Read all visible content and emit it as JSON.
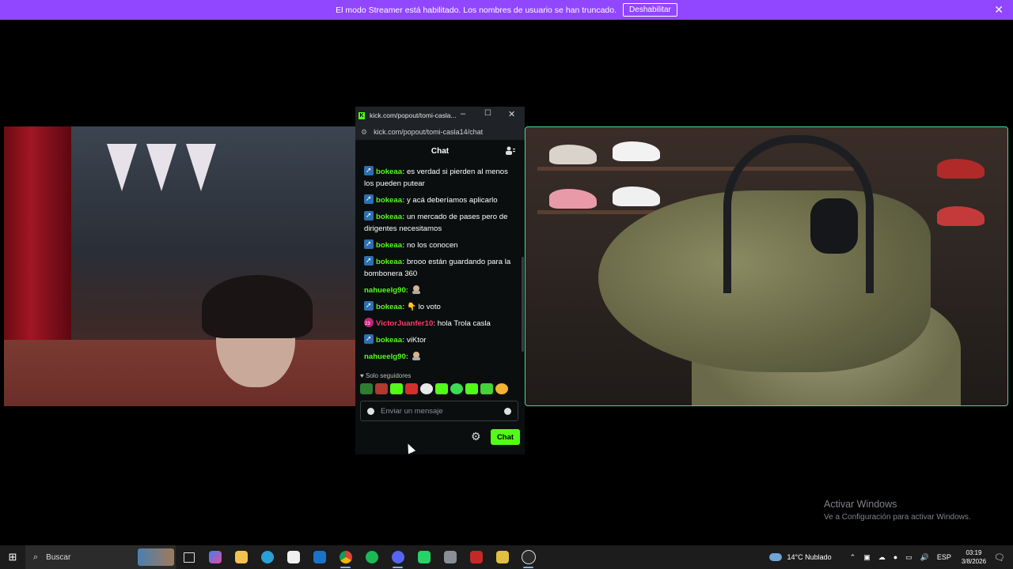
{
  "banner": {
    "text": "El modo Streamer está habilitado. Los nombres de usuario se han truncado.",
    "button": "Deshabilitar",
    "close": "✕"
  },
  "popup": {
    "window_title": "kick.com/popout/tomi-casla...",
    "url": "kick.com/popout/tomi-casla14/chat",
    "chat_title": "Chat",
    "messages": [
      {
        "user": "bokeaa",
        "text": "es verdad si pierden al menos los pueden putear"
      },
      {
        "user": "bokeaa",
        "text": "y acá deberíamos aplicarlo"
      },
      {
        "user": "bokeaa",
        "text": "un mercado de pases pero de dirigentes necesitamos"
      },
      {
        "user": "bokeaa",
        "text": "no los conocen"
      },
      {
        "user": "bokeaa",
        "text": "brooo están guardando para la bombonera 360"
      },
      {
        "user": "nahueelg90",
        "text": ""
      },
      {
        "user": "bokeaa",
        "text": "lo voto"
      },
      {
        "user": "VictorJuanfer10",
        "text": "hola Trola casla"
      },
      {
        "user": "bokeaa",
        "text": "viKtor"
      },
      {
        "user": "nahueelg90",
        "text": ""
      }
    ],
    "followers_only": "Solo seguidores",
    "input_placeholder": "Enviar un mensaje",
    "send_button": "Chat"
  },
  "watermark": {
    "title": "Activar Windows",
    "subtitle": "Ve a Configuración para activar Windows."
  },
  "taskbar": {
    "search_label": "Buscar",
    "weather_temp": "14°C",
    "weather_desc": "Nublado",
    "language": "ESP",
    "time": "03:19",
    "date": "3/8/2026"
  },
  "colors": {
    "kick_green": "#53fc18",
    "banner_purple": "#9146ff",
    "highlight_pink": "#ff3b6b"
  }
}
